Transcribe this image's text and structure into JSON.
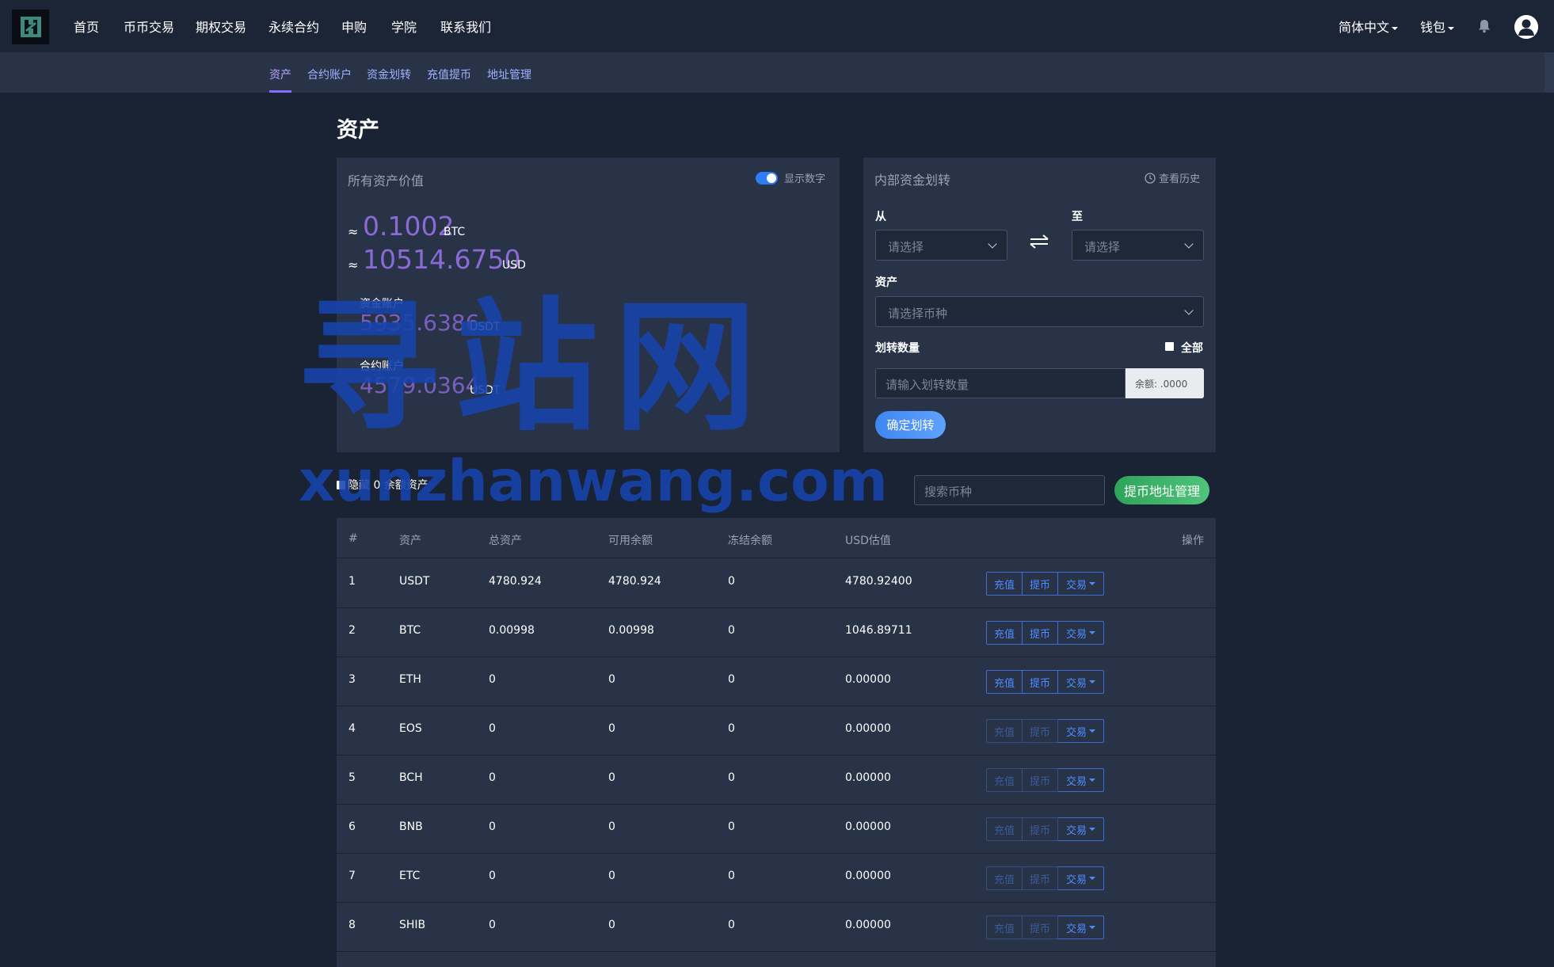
{
  "nav": {
    "items": [
      "首页",
      "币币交易",
      "期权交易",
      "永续合约",
      "申购",
      "学院",
      "联系我们"
    ],
    "language": "简体中文",
    "wallet": "钱包"
  },
  "subnav": {
    "items": [
      "资产",
      "合约账户",
      "资金划转",
      "充值提币",
      "地址管理"
    ],
    "active_index": 0
  },
  "page_title": "资产",
  "assets_card": {
    "title": "所有资产价值",
    "toggle_label": "显示数字",
    "toggle_on": true,
    "approx_symbol": "≈",
    "btc_value": "0.1002",
    "btc_unit": "BTC",
    "usd_value": "10514.6750",
    "usd_unit": "USD",
    "fund_account_label": "资金账户",
    "fund_account_value": "5935.6386",
    "fund_account_unit": "USDT",
    "contract_account_label": "合约账户",
    "contract_account_value": "4579.0364",
    "contract_account_unit": "USDT"
  },
  "transfer_card": {
    "title": "内部资金划转",
    "history": "查看历史",
    "from_label": "从",
    "to_label": "至",
    "from_placeholder": "请选择",
    "to_placeholder": "请选择",
    "asset_label": "资产",
    "asset_placeholder": "请选择币种",
    "amount_label": "划转数量",
    "all_label": "全部",
    "amount_placeholder": "请输入划转数量",
    "balance": "余额: .0000",
    "confirm": "确定划转"
  },
  "filters": {
    "hide_zero": "隐藏 0 余额资产",
    "search_placeholder": "搜索币种",
    "address_button": "提币地址管理"
  },
  "table": {
    "headers": [
      "#",
      "资产",
      "总资产",
      "可用余额",
      "冻结余额",
      "USD估值",
      "操作"
    ],
    "buttons": {
      "deposit": "充值",
      "withdraw": "提币",
      "trade": "交易"
    },
    "rows": [
      {
        "no": "1",
        "asset": "USDT",
        "total": "4780.924",
        "available": "4780.924",
        "frozen": "0",
        "usd": "4780.92400",
        "enabled": true
      },
      {
        "no": "2",
        "asset": "BTC",
        "total": "0.00998",
        "available": "0.00998",
        "frozen": "0",
        "usd": "1046.89711",
        "enabled": true
      },
      {
        "no": "3",
        "asset": "ETH",
        "total": "0",
        "available": "0",
        "frozen": "0",
        "usd": "0.00000",
        "enabled": true
      },
      {
        "no": "4",
        "asset": "EOS",
        "total": "0",
        "available": "0",
        "frozen": "0",
        "usd": "0.00000",
        "enabled": false
      },
      {
        "no": "5",
        "asset": "BCH",
        "total": "0",
        "available": "0",
        "frozen": "0",
        "usd": "0.00000",
        "enabled": false
      },
      {
        "no": "6",
        "asset": "BNB",
        "total": "0",
        "available": "0",
        "frozen": "0",
        "usd": "0.00000",
        "enabled": false
      },
      {
        "no": "7",
        "asset": "ETC",
        "total": "0",
        "available": "0",
        "frozen": "0",
        "usd": "0.00000",
        "enabled": false
      },
      {
        "no": "8",
        "asset": "SHIB",
        "total": "0",
        "available": "0",
        "frozen": "0",
        "usd": "0.00000",
        "enabled": false
      }
    ]
  },
  "watermark": {
    "title": "寻站网",
    "url": "xunzhanwang.com"
  },
  "colors": {
    "background": "#1a2333",
    "card": "#283348",
    "accent_purple": "#8a6bd6",
    "accent_blue": "#3f86f0",
    "accent_green": "#2fa35a"
  }
}
